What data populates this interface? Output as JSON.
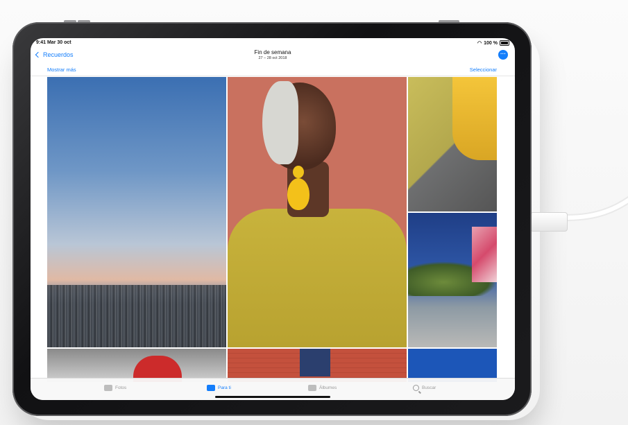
{
  "status": {
    "time": "9:41",
    "date": "Mar 30 oct",
    "battery": "100 %"
  },
  "nav": {
    "back_label": "Recuerdos",
    "title": "Fin de semana",
    "subtitle": "27 – 28 oct 2018",
    "more_icon": "ellipsis-circle-icon"
  },
  "subnav": {
    "left": "Mostrar más",
    "right": "Seleccionar"
  },
  "tabs": [
    {
      "label": "Fotos",
      "icon": "photos-icon",
      "active": false
    },
    {
      "label": "Para ti",
      "icon": "for-you-icon",
      "active": true
    },
    {
      "label": "Álbumes",
      "icon": "albums-icon",
      "active": false
    },
    {
      "label": "Buscar",
      "icon": "search-icon",
      "active": false
    }
  ],
  "colors": {
    "accent": "#147efb"
  }
}
